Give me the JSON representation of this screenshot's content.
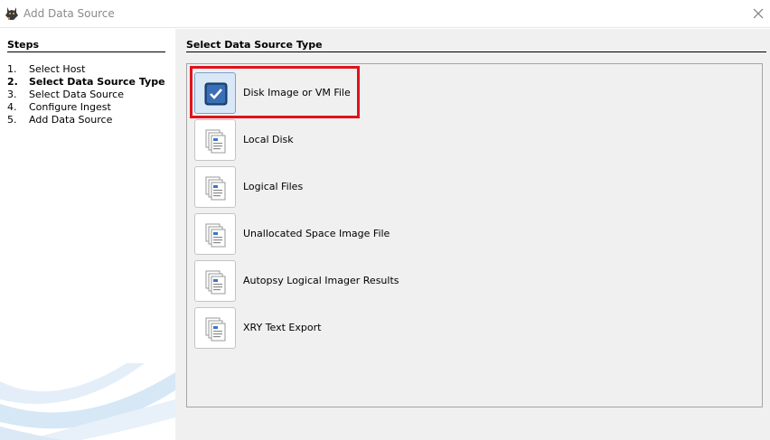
{
  "window": {
    "title": "Add Data Source",
    "app_icon": "autopsy-dog-icon",
    "close_icon": "close-icon"
  },
  "sidebar": {
    "title": "Steps",
    "steps": [
      {
        "number": "1.",
        "label": "Select Host",
        "active": false
      },
      {
        "number": "2.",
        "label": "Select Data Source Type",
        "active": true
      },
      {
        "number": "3.",
        "label": "Select Data Source",
        "active": false
      },
      {
        "number": "4.",
        "label": "Configure Ingest",
        "active": false
      },
      {
        "number": "5.",
        "label": "Add Data Source",
        "active": false
      }
    ]
  },
  "main": {
    "title": "Select Data Source Type",
    "options": [
      {
        "label": "Disk Image or VM File",
        "icon": "disk-image-check-icon",
        "selected": true
      },
      {
        "label": "Local Disk",
        "icon": "document-stack-icon",
        "selected": false
      },
      {
        "label": "Logical Files",
        "icon": "document-stack-icon",
        "selected": false
      },
      {
        "label": "Unallocated Space Image File",
        "icon": "document-stack-icon",
        "selected": false
      },
      {
        "label": "Autopsy Logical Imager Results",
        "icon": "document-stack-icon",
        "selected": false
      },
      {
        "label": "XRY Text Export",
        "icon": "document-stack-icon",
        "selected": false
      }
    ]
  },
  "colors": {
    "highlight_box": "#e0121b",
    "selected_button": "#d9e8f7",
    "panel_background": "#f0f0f0"
  }
}
